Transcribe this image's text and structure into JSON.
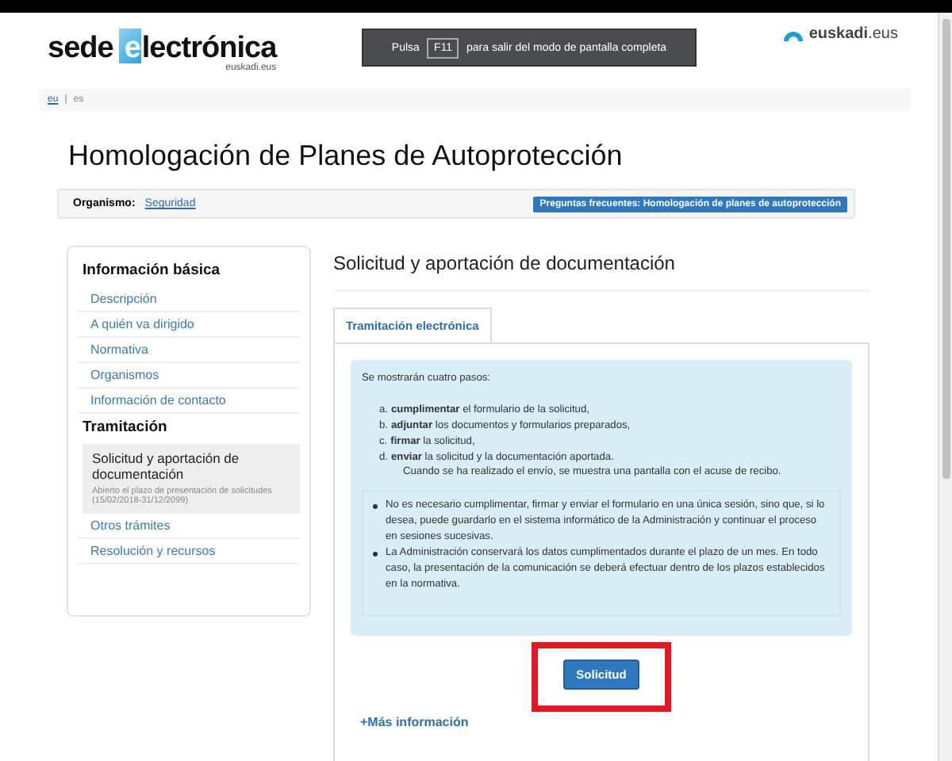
{
  "header": {
    "logo": {
      "first": "sede",
      "box_letter": "e",
      "rest": "lectrónica",
      "sub": "euskadi.eus"
    },
    "fullscreen_notice": {
      "before": "Pulsa",
      "key": "F11",
      "after": "para salir del modo de pantalla completa"
    },
    "brand": {
      "name": "euskadi",
      "suffix": ".eus"
    }
  },
  "languages": [
    {
      "label": "eu",
      "selected": false
    },
    {
      "label": "es",
      "selected": true
    }
  ],
  "language_separator": "|",
  "page": {
    "title": "Homologación de Planes de Autoprotección",
    "organism_label": "Organismo:",
    "organism_value": "Seguridad",
    "faq_button": "Preguntas frecuentes: Homologación de planes de autoprotección"
  },
  "sidebar": [
    {
      "title": "Información básica",
      "items": [
        {
          "label": "Descripción",
          "selected": false
        },
        {
          "label": "A quién va dirigido",
          "selected": false
        },
        {
          "label": "Normativa",
          "selected": false
        },
        {
          "label": "Organismos",
          "selected": false
        },
        {
          "label": "Información de contacto",
          "selected": false
        }
      ]
    },
    {
      "title": "Tramitación",
      "items": [
        {
          "label": "Solicitud y aportación de documentación",
          "selected": true,
          "note": "Abierto el plazo de presentación de solicitudes (15/02/2018-31/12/2099)"
        },
        {
          "label": "Otros trámites",
          "selected": false
        },
        {
          "label": "Resolución y recursos",
          "selected": false
        }
      ]
    }
  ],
  "main": {
    "heading": "Solicitud y aportación de documentación",
    "tabs": [
      {
        "label": "Tramitación electrónica",
        "selected": true
      }
    ],
    "intro": "Se mostrarán cuatro pasos:",
    "steps": [
      {
        "marker": "a.",
        "text": "**cumplimentar** el formulario de la solicitud,"
      },
      {
        "marker": "b.",
        "text": "**adjuntar** los documentos y formularios preparados,"
      },
      {
        "marker": "c.",
        "text": "**firmar** la solicitud,"
      },
      {
        "marker": "d.",
        "text": "**enviar** la solicitud y la documentación aportada."
      }
    ],
    "steps_note": "Cuando se ha realizado el envío, se muestra una pantalla con el acuse de recibo.",
    "bullets": [
      "No es necesario cumplimentar, firmar y enviar el formulario en una única sesión, sino que, si lo desea, puede guardarlo en el sistema informático de la Administración y continuar el proceso en sesiones sucesivas.",
      "La Administración conservará los datos cumplimentados durante el plazo de un mes. En todo caso, la presentación de la comunicación se deberá efectuar dentro de los plazos establecidos en la normativa."
    ],
    "button": {
      "label": "Solicitud",
      "highlighted": true
    },
    "more_link": "+Más información"
  }
}
